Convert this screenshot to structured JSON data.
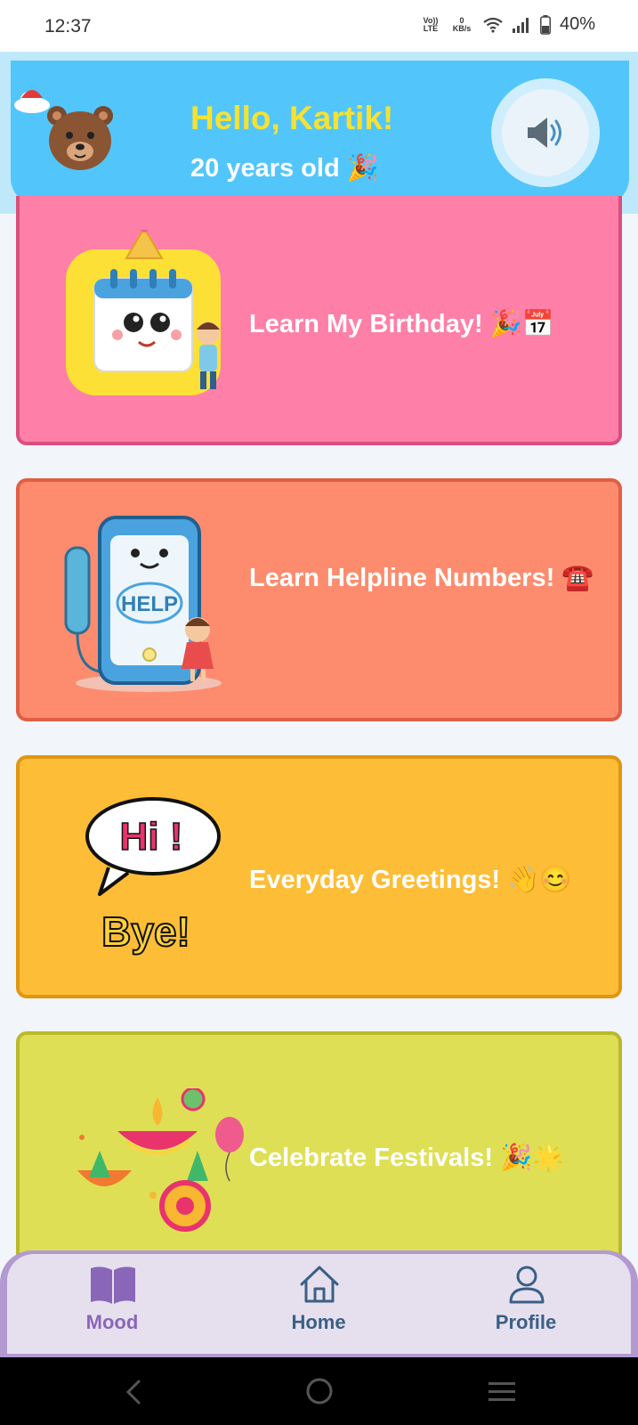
{
  "status_bar": {
    "time": "12:37",
    "network_top": "Vo)) LTE",
    "speed_value": "0",
    "speed_unit": "KB/s",
    "battery": "40%"
  },
  "header": {
    "greeting": "Hello, Kartik!",
    "age_text": "20 years old 🎉",
    "speaker_icon": "speaker-icon"
  },
  "cards": [
    {
      "label": "Learn My Birthday! 🎉📅",
      "color": "#fe7fa8",
      "border": "#d94f7d",
      "icon": "birthday-calendar-illustration"
    },
    {
      "label": "Learn Helpline Numbers! ☎️",
      "color": "#fd8c6e",
      "border": "#e15f45",
      "icon": "helpline-phone-illustration"
    },
    {
      "label": "Everyday Greetings! 👋😊",
      "color": "#fdbd36",
      "border": "#e09612",
      "icon": "hi-bye-speech-bubble-illustration"
    },
    {
      "label": "Celebrate Festivals! 🎉🌟",
      "color": "#dfdf56",
      "border": "#b9b92a",
      "icon": "festival-diya-illustration"
    }
  ],
  "calendar_badge": {
    "month": "July",
    "day": "17"
  },
  "greeting_art": {
    "hi": "Hi !",
    "bye": "Bye!"
  },
  "helpline_art": {
    "help": "HELP"
  },
  "bottom_nav": {
    "items": [
      {
        "label": "Mood",
        "icon": "book-icon",
        "active": true
      },
      {
        "label": "Home",
        "icon": "home-icon",
        "active": false
      },
      {
        "label": "Profile",
        "icon": "person-icon",
        "active": false
      }
    ],
    "active_color": "#8a66b8",
    "inactive_color": "#3b5f86"
  }
}
